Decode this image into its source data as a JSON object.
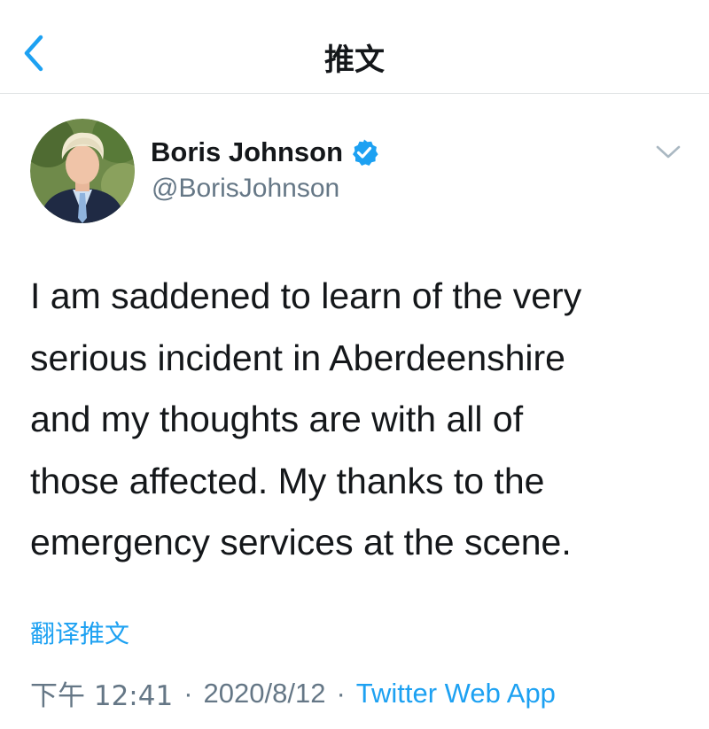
{
  "nav": {
    "title": "推文",
    "back_icon": "chevron-left-icon",
    "accent_color": "#1da1f2"
  },
  "tweet": {
    "author": {
      "display_name": "Boris Johnson",
      "handle": "@BorisJohnson",
      "verified": true,
      "verified_icon": "verified-badge-icon"
    },
    "more_icon": "chevron-down-icon",
    "text": "I am saddened to learn of the very\nserious incident in Aberdeenshire\nand my thoughts are with all of\nthose affected. My thanks to the\nemergency services at the scene.",
    "translate_label": "翻译推文",
    "time": "下午 12:41",
    "separator_1": "·",
    "date": "2020/8/12",
    "separator_2": "·",
    "source": "Twitter Web App"
  },
  "colors": {
    "text_primary": "#14171a",
    "text_secondary": "#657786",
    "link": "#1da1f2",
    "divider": "#e1e4e6"
  }
}
